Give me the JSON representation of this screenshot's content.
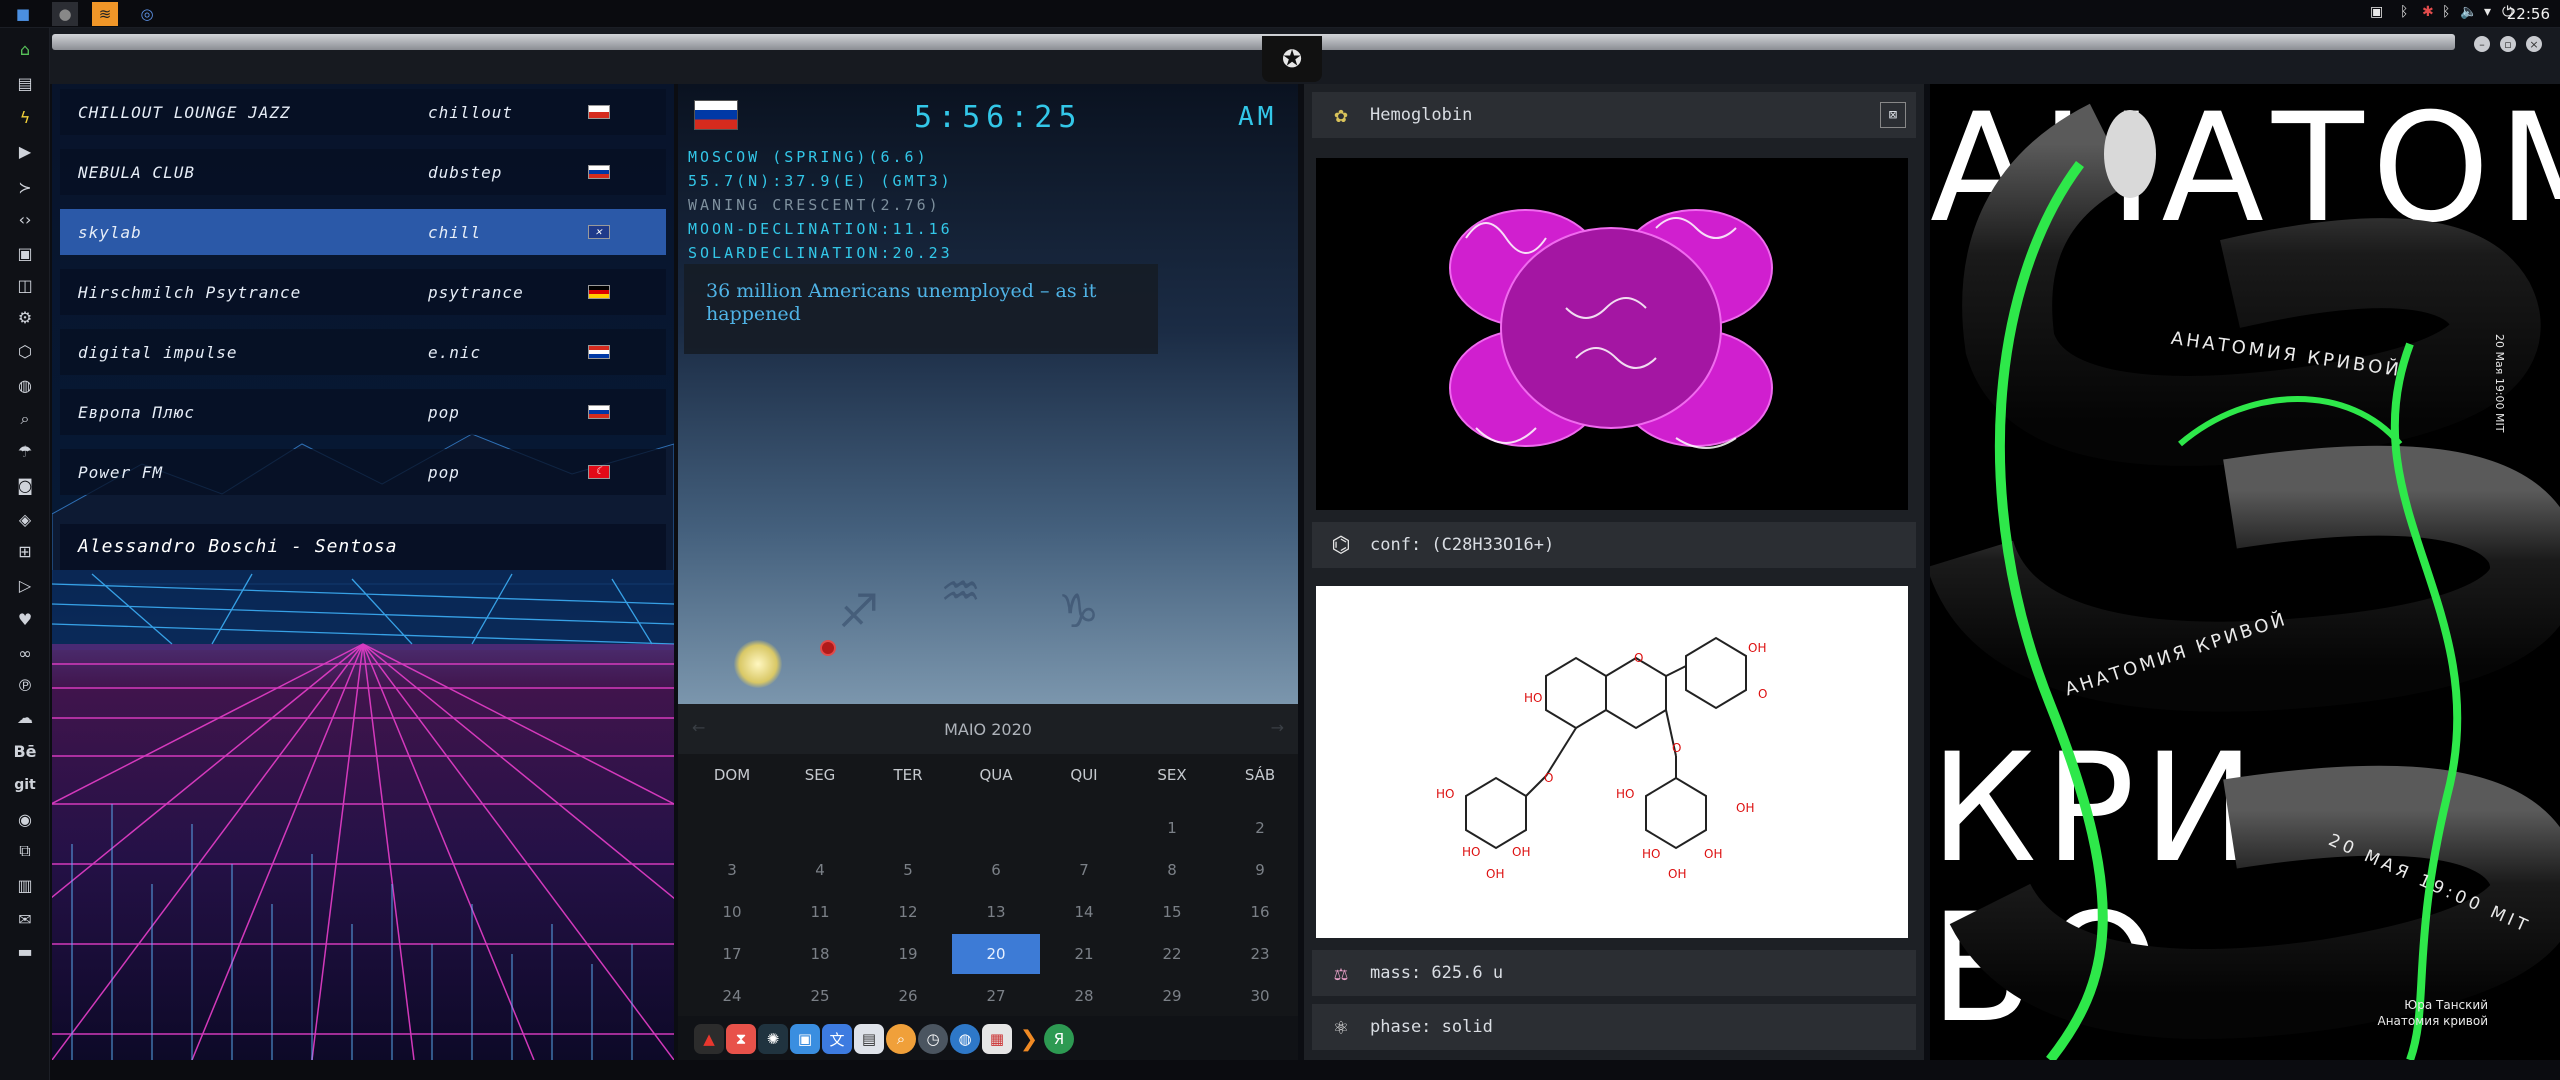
{
  "taskbar": {
    "clock": "22:56",
    "tray_icons": [
      "image-icon",
      "bluetooth-icon",
      "lock-icon",
      "bluetooth-icon",
      "volume-icon",
      "wifi-icon"
    ]
  },
  "dock_icons": [
    "home-icon",
    "document-icon",
    "bolt-icon",
    "play-icon",
    "terminal-icon",
    "code-icon",
    "video-icon",
    "image-icon",
    "gear-icon",
    "hexagon-icon",
    "globe-icon",
    "search-icon",
    "weather-icon",
    "contacts-icon",
    "tag-icon",
    "grid-icon",
    "youtube-icon",
    "heart-icon",
    "link-icon",
    "pinterest-icon",
    "cloud-icon",
    "behance-icon",
    "git-icon",
    "github-icon",
    "cube-icon",
    "map-icon",
    "mail-icon",
    "trash-icon"
  ],
  "radio": {
    "stations": [
      {
        "name": "CHILLOUT LOUNGE JAZZ",
        "genre": "chillout"
      },
      {
        "name": "NEBULA CLUB",
        "genre": "dubstep"
      },
      {
        "name": "skylab",
        "genre": "chill"
      },
      {
        "name": "Hirschmilch Psytrance",
        "genre": "psytrance"
      },
      {
        "name": "digital impulse",
        "genre": "e.nic"
      },
      {
        "name": "Европа Плюс",
        "genre": "pop"
      },
      {
        "name": "Power FM",
        "genre": "pop"
      }
    ],
    "now_playing": "Alessandro Boschi - Sentosa"
  },
  "sky": {
    "time": "5:56:25",
    "ampm": "AM",
    "lines": [
      "MOSCOW (SPRING)(6.6)",
      "55.7(N):37.9(E) (GMT3)",
      "WANING CRESCENT(2.76)",
      "MOON-DECLINATION:11.16",
      "SOLARDECLINATION:20.23"
    ],
    "headline": "36 million Americans unemployed – as it happened"
  },
  "calendar": {
    "month": "MAIO 2020",
    "weekdays": [
      "DOM",
      "SEG",
      "TER",
      "QUA",
      "QUI",
      "SEX",
      "SÁB"
    ],
    "first_weekday": 5,
    "days_shown": 30,
    "today": 20
  },
  "chem": {
    "name": "Hemoglobin",
    "conf": "conf: (C28H33O16+)",
    "mass": "mass: 625.6 u",
    "phase": "phase: solid"
  },
  "poster": {
    "line1": "АНАТОМ",
    "line2": "КРИ",
    "line3": "ВО",
    "ring_text": "АНАТОМИЯ КРИВОЙ",
    "date_text": "20 МАЯ 19:00 MIT",
    "side_text": "20 Мая 19:00 MIT",
    "credit1": "Юра Танский",
    "credit2": "Анатомия кривой",
    "accent": "#2ee84a"
  },
  "colors": {
    "selected_station": "#2b59a8",
    "clock_cyan": "#33c7e8",
    "today": "#3d7bd6"
  }
}
